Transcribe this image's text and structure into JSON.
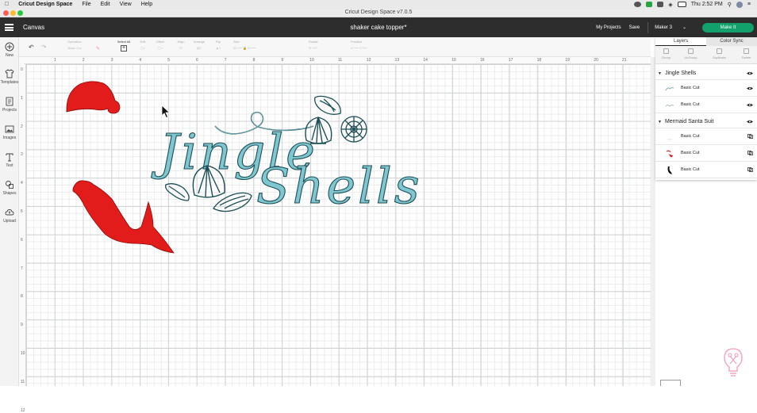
{
  "mac_menu": {
    "app_name": "Cricut Design Space",
    "items": [
      "File",
      "Edit",
      "View",
      "Help"
    ],
    "clock": "Thu 2:52 PM"
  },
  "window": {
    "title": "Cricut Design Space  v7.0.5"
  },
  "header": {
    "section": "Canvas",
    "document_title": "shaker cake topper*",
    "my_projects": "My Projects",
    "save": "Save",
    "machine": "Maker 3",
    "make_it": "Make It"
  },
  "sidebar": {
    "items": [
      {
        "label": "New",
        "icon": "plus-circle-icon"
      },
      {
        "label": "Templates",
        "icon": "tshirt-icon"
      },
      {
        "label": "Projects",
        "icon": "projects-icon"
      },
      {
        "label": "Images",
        "icon": "image-icon"
      },
      {
        "label": "Text",
        "icon": "text-T-icon"
      },
      {
        "label": "Shapes",
        "icon": "shapes-icon"
      },
      {
        "label": "Upload",
        "icon": "cloud-upload-icon"
      }
    ]
  },
  "toolbar": {
    "select_all": "Select All",
    "operation": "Operation",
    "operation_value": "Basic Cut",
    "edit": "Edit",
    "offset": "Offset",
    "align": "Align",
    "arrange": "Arrange",
    "flip": "Flip",
    "size": "Size",
    "rotate": "Rotate",
    "position": "Position"
  },
  "ruler": {
    "top": [
      "1",
      "2",
      "3",
      "4",
      "5",
      "6",
      "7",
      "8",
      "9",
      "10",
      "11",
      "12",
      "13",
      "14",
      "15",
      "16",
      "17",
      "18",
      "19",
      "20",
      "21"
    ],
    "left": [
      "0",
      "1",
      "2",
      "3",
      "4",
      "5",
      "6",
      "7",
      "8",
      "9",
      "10",
      "11",
      "12"
    ]
  },
  "layers_panel": {
    "tabs": [
      "Layers",
      "Color Sync"
    ],
    "actions": [
      "Group",
      "UnGroup",
      "Duplicate",
      "Delete"
    ],
    "groups": [
      {
        "name": "Jingle Shells",
        "layers": [
          {
            "label": "Basic Cut"
          },
          {
            "label": "Basic Cut"
          }
        ]
      },
      {
        "name": "Mermaid Santa Suit",
        "layers": [
          {
            "label": "Basic Cut"
          },
          {
            "label": "Basic Cut"
          },
          {
            "label": "Basic Cut"
          }
        ]
      }
    ]
  },
  "canvas_design": {
    "text_line_1": "Jingle",
    "text_line_2": "Shells",
    "text_color": "#7fc6d0",
    "outline_color": "#1c4e55",
    "red": "#e21b1b"
  },
  "colors": {
    "accent": "#12a16a",
    "header_bg": "#2d2d2d"
  }
}
